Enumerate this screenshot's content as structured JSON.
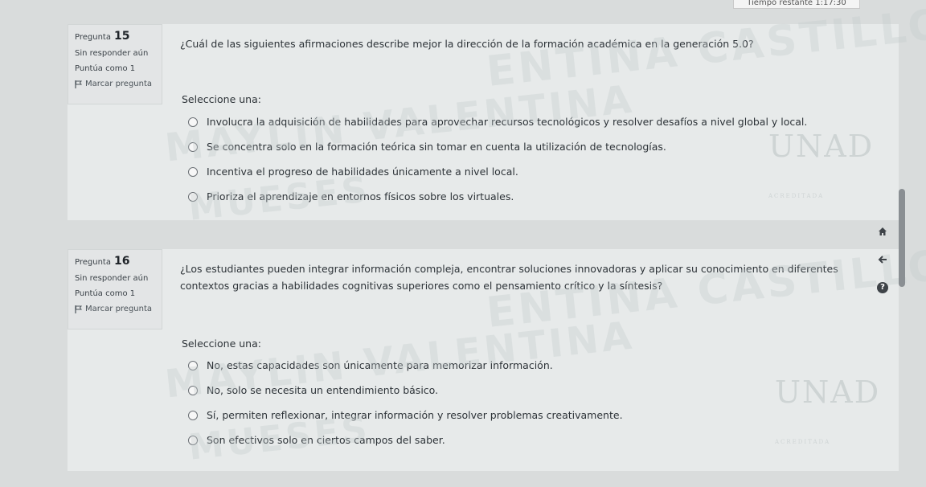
{
  "timer": {
    "label": "Tiempo restante 1:17:30"
  },
  "questions": [
    {
      "label": "Pregunta",
      "number": "15",
      "status": "Sin responder aún",
      "points": "Puntúa como 1",
      "flag_label": "Marcar pregunta",
      "text": "¿Cuál de las siguientes afirmaciones describe mejor la dirección de la formación académica en la generación 5.0?",
      "prompt": "Seleccione una:",
      "options": [
        "Involucra la adquisición de habilidades para aprovechar recursos tecnológicos y resolver desafíos a nivel global y local.",
        "Se concentra solo en la formación teórica sin tomar en cuenta la utilización de tecnologías.",
        "Incentiva el progreso de habilidades únicamente a nivel local.",
        "Prioriza el aprendizaje en entornos físicos sobre los virtuales."
      ]
    },
    {
      "label": "Pregunta",
      "number": "16",
      "status": "Sin responder aún",
      "points": "Puntúa como 1",
      "flag_label": "Marcar pregunta",
      "text": "¿Los estudiantes pueden integrar información compleja, encontrar soluciones innovadoras y aplicar su conocimiento en diferentes contextos gracias a habilidades cognitivas superiores como el pensamiento crítico y la síntesis?",
      "prompt": "Seleccione una:",
      "options": [
        "No, estas capacidades son únicamente para memorizar información.",
        "No, solo se necesita un entendimiento básico.",
        "Sí, permiten reflexionar, integrar información y resolver problemas creativamente.",
        "Son efectivos solo en ciertos campos del saber."
      ]
    }
  ],
  "side": {
    "help_glyph": "?"
  },
  "watermark": {
    "line1": "ENTINA CASTILLO",
    "line2": "MAYLIN VALENTINA",
    "line3": "MUESES",
    "logo": "UNAD",
    "logo_sub": "ACREDITADA"
  },
  "icons": {
    "flag": "flag-icon",
    "home": "home-icon",
    "back": "arrow-left-icon",
    "help": "help-icon"
  }
}
